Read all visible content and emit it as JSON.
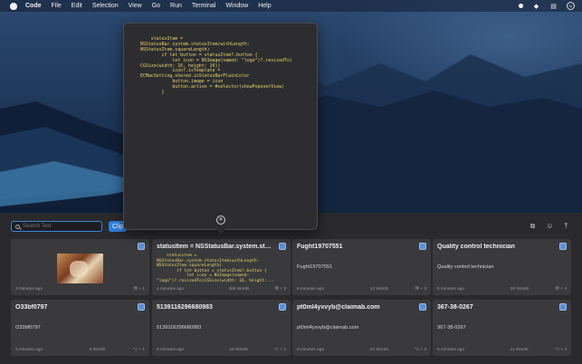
{
  "menubar": {
    "items": [
      "Code",
      "File",
      "Edit",
      "Selection",
      "View",
      "Go",
      "Run",
      "Terminal",
      "Window",
      "Help"
    ]
  },
  "toolbar": {
    "search_placeholder": "Search Text",
    "tab_label": "Clip"
  },
  "popover": {
    "code": "    statusItem =\nNSStatusBar.system.statusItem(withLength:\nNSStatusItem.squareLength)\n        if let button = statusItem?.button {\n            let icon = NSImage(named: \"logo\")?.resizedTo(\nCGSize(width: 16, height: 16))\n            icon?.isTemplate =\nECMacSetting.shared.isStatusBarPlainColor\n            button.image = icon\n            button.action = #selector(showPopoverView)\n        }",
    "close_icon": "close-icon"
  },
  "cards": [
    {
      "title": "",
      "body": "",
      "code": "",
      "time": "3 minutes ago",
      "words": "",
      "key": "⌘ + 1",
      "image": true
    },
    {
      "title": "statusItem = NSStatusBar.system.statusItem(withLength:",
      "body": "",
      "code": "    statusItem =\nNSStatusBar.system.statusItem(withLength:\nNSStatusItem.squareLength)\n        if let button = statusItem?.button {\n            let icon = NSImage(named:\n\"logo\")?.resizedTo(CGSize(width: 16, height:...",
      "time": "4 minutes ago",
      "words": "366 Words",
      "key": "⌘ + 2",
      "image": false
    },
    {
      "title": "Fught19707551",
      "body": "Fught19707551",
      "code": "",
      "time": "6 minutes ago",
      "words": "13 Words",
      "key": "⌘ + 3",
      "image": false
    },
    {
      "title": "Quality control technician",
      "body": "Quality control technician",
      "code": "",
      "time": "6 minutes ago",
      "words": "26 Words",
      "key": "⌘ + 4",
      "image": false
    },
    {
      "title": "O33bf0797",
      "body": "O33bf0797",
      "code": "",
      "time": "6 minutes ago",
      "words": "9 Words",
      "key": "⌥ + 1",
      "image": false
    },
    {
      "title": "5139116296680983",
      "body": "5139116296680983",
      "code": "",
      "time": "6 minutes ago",
      "words": "16 Words",
      "key": "⌥ + 2",
      "image": false
    },
    {
      "title": "pt0ml4yxvyb@claimab.com",
      "body": "pt0ml4yxvyb@claimab.com",
      "code": "",
      "time": "6 minutes ago",
      "words": "23 Words",
      "key": "⌥ + 3",
      "image": false
    },
    {
      "title": "367-38-0267",
      "body": "367-38-0267",
      "code": "",
      "time": "6 minutes ago",
      "words": "11 Words",
      "key": "⌥ + 4",
      "image": false
    }
  ],
  "colors": {
    "accent": "#2f7fe0",
    "code_text": "#e8d66a",
    "card_bg": "#3a3a3d",
    "panel_bg": "#2a2a2d"
  }
}
